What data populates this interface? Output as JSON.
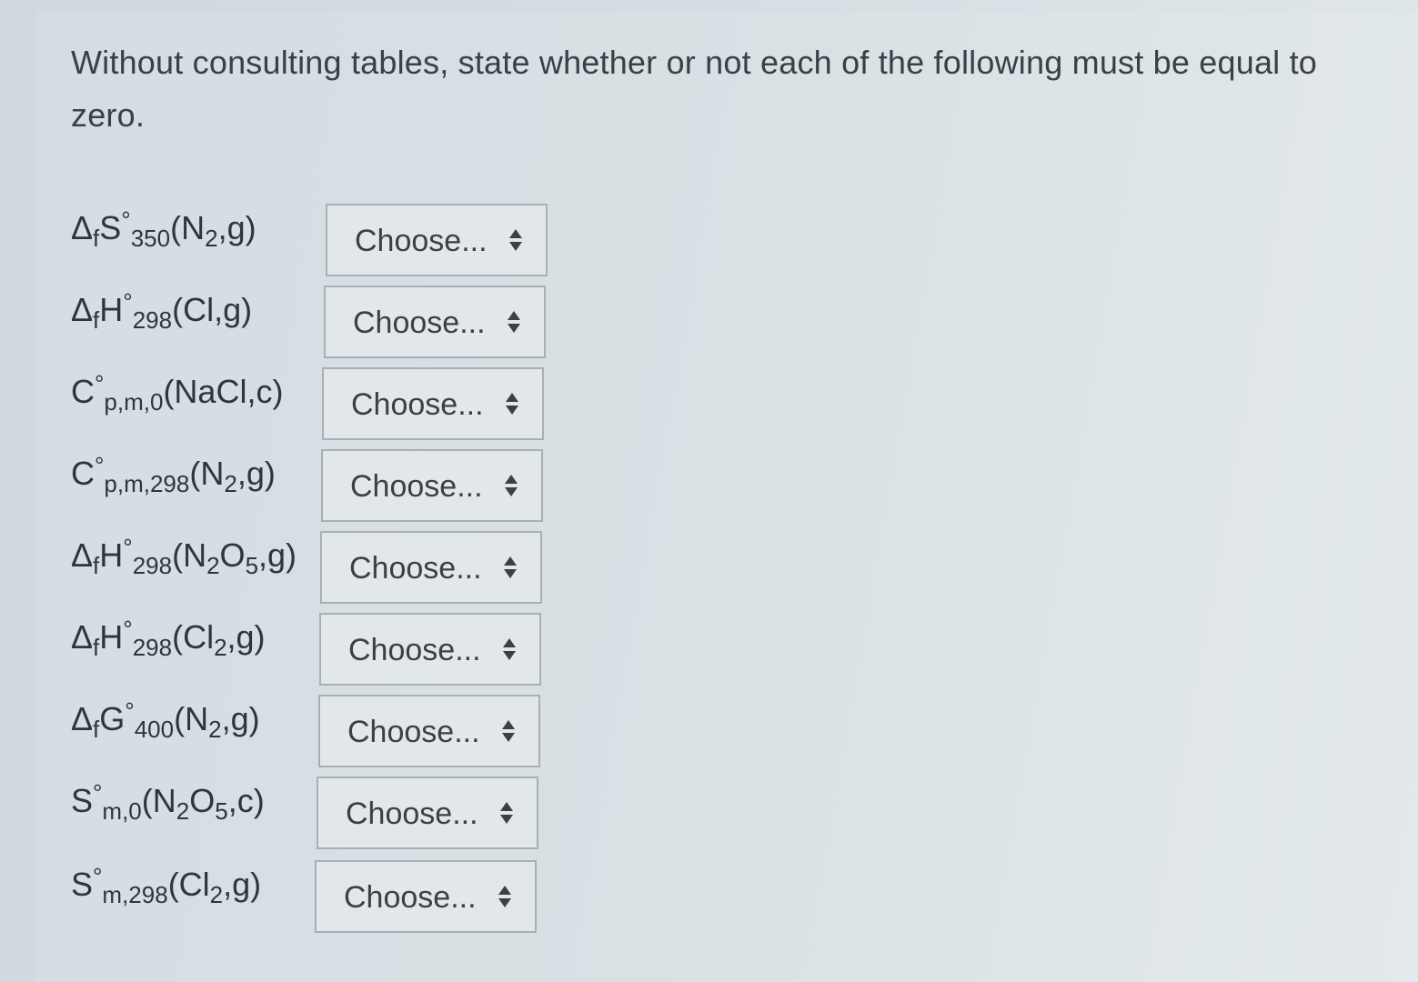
{
  "question": {
    "text": "Without consulting tables, state whether or not each of the following must be equal to zero."
  },
  "rows": [
    {
      "delta": "Δ",
      "dsub": "f",
      "sym": "S",
      "deg": "°",
      "subscript": "350",
      "tail": "(N",
      "t_sub": "2",
      "tail2": ",g)",
      "t_sub2": "",
      "tail3": "",
      "select_value": "Choose..."
    },
    {
      "delta": "Δ",
      "dsub": "f",
      "sym": "H",
      "deg": "°",
      "subscript": "298",
      "tail": "(Cl,g)",
      "t_sub": "",
      "tail2": "",
      "t_sub2": "",
      "tail3": "",
      "select_value": "Choose..."
    },
    {
      "delta": "",
      "dsub": "",
      "sym": "C",
      "deg": "°",
      "subscript": "p,m,0",
      "tail": "(NaCl,c)",
      "t_sub": "",
      "tail2": "",
      "t_sub2": "",
      "tail3": "",
      "select_value": "Choose..."
    },
    {
      "delta": "",
      "dsub": "",
      "sym": "C",
      "deg": "°",
      "subscript": "p,m,298",
      "tail": "(N",
      "t_sub": "2",
      "tail2": ",g)",
      "t_sub2": "",
      "tail3": "",
      "select_value": "Choose..."
    },
    {
      "delta": "Δ",
      "dsub": "f",
      "sym": "H",
      "deg": "°",
      "subscript": "298",
      "tail": "(N",
      "t_sub": "2",
      "tail2": "O",
      "t_sub2": "5",
      "tail3": ",g)",
      "select_value": "Choose..."
    },
    {
      "delta": "Δ",
      "dsub": "f",
      "sym": "H",
      "deg": "°",
      "subscript": "298",
      "tail": "(Cl",
      "t_sub": "2",
      "tail2": ",g)",
      "t_sub2": "",
      "tail3": "",
      "select_value": "Choose..."
    },
    {
      "delta": "Δ",
      "dsub": "f",
      "sym": "G",
      "deg": "°",
      "subscript": "400",
      "tail": "(N",
      "t_sub": "2",
      "tail2": ",g)",
      "t_sub2": "",
      "tail3": "",
      "select_value": "Choose..."
    },
    {
      "delta": "",
      "dsub": "",
      "sym": "S",
      "deg": "°",
      "subscript": "m,0",
      "tail": "(N",
      "t_sub": "2",
      "tail2": "O",
      "t_sub2": "5",
      "tail3": ",c)",
      "select_value": "Choose..."
    },
    {
      "delta": "",
      "dsub": "",
      "sym": "S",
      "deg": "°",
      "subscript": "m,298",
      "tail": "(Cl",
      "t_sub": "2",
      "tail2": ",g)",
      "t_sub2": "",
      "tail3": "",
      "select_value": "Choose..."
    }
  ]
}
